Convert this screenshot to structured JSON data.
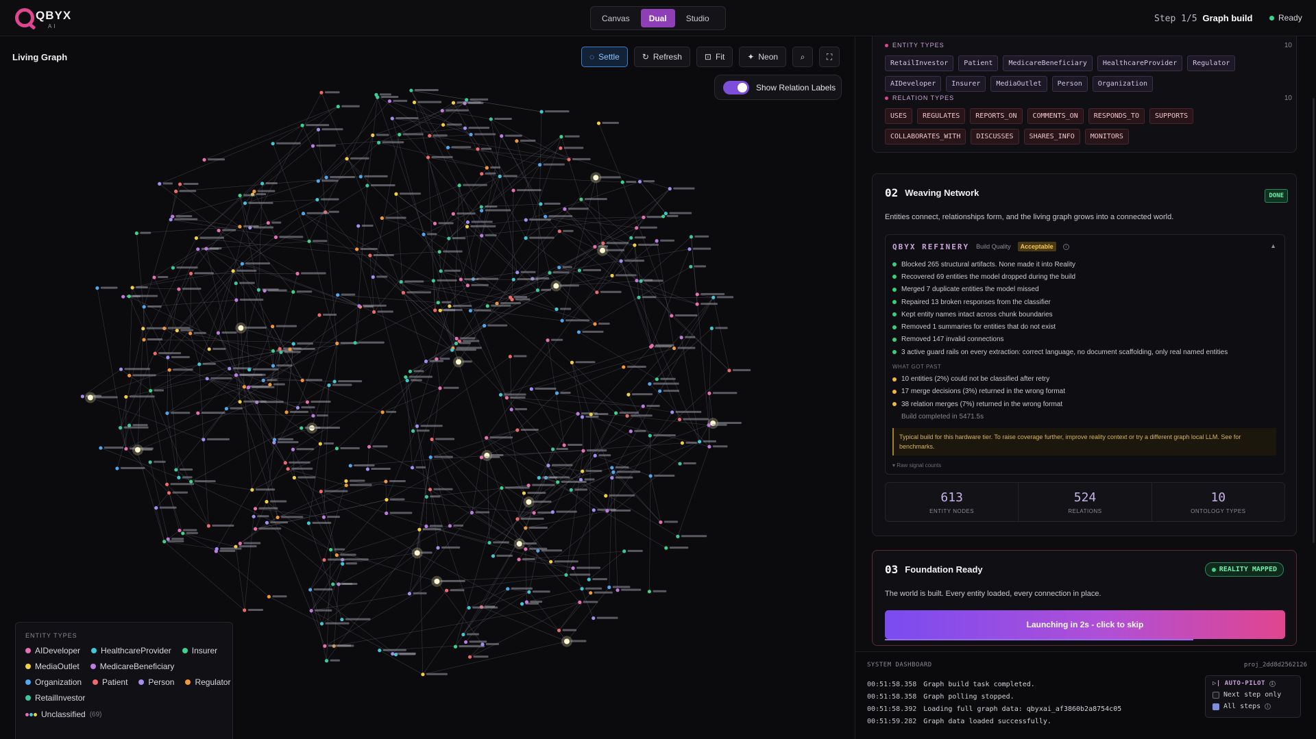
{
  "app": {
    "logo_text": "QBYX",
    "logo_sub": "AI",
    "modes": [
      "Canvas",
      "Dual",
      "Studio"
    ],
    "active_mode": "Dual",
    "step_prefix": "Step 1/5",
    "step_name": "Graph build",
    "status": "Ready"
  },
  "graph": {
    "title": "Living Graph",
    "tools": {
      "settle": "Settle",
      "refresh": "Refresh",
      "fit": "Fit",
      "neon": "Neon"
    },
    "toggle_label": "Show Relation Labels",
    "toggle_on": true,
    "legend_title": "ENTITY TYPES",
    "legend": [
      {
        "label": "AIDeveloper",
        "color": "#e86fb3"
      },
      {
        "label": "HealthcareProvider",
        "color": "#3fc9d8"
      },
      {
        "label": "Insurer",
        "color": "#3ad48a"
      },
      {
        "label": "MediaOutlet",
        "color": "#f3cf43"
      },
      {
        "label": "MedicareBeneficiary",
        "color": "#c07be3"
      },
      {
        "label": "Organization",
        "color": "#4fa8f0"
      },
      {
        "label": "Patient",
        "color": "#f06a6a"
      },
      {
        "label": "Person",
        "color": "#a48ef0"
      },
      {
        "label": "Regulator",
        "color": "#f2983a"
      },
      {
        "label": "RetailInvestor",
        "color": "#3cc99a"
      }
    ],
    "unclassified_label": "Unclassified",
    "unclassified_count": "(69)"
  },
  "ontology": {
    "entity_types_label": "ENTITY TYPES",
    "entity_types_count": "10",
    "entity_types": [
      "RetailInvestor",
      "Patient",
      "MedicareBeneficiary",
      "HealthcareProvider",
      "Regulator",
      "AIDeveloper",
      "Insurer",
      "MediaOutlet",
      "Person",
      "Organization"
    ],
    "relation_types_label": "RELATION TYPES",
    "relation_types_count": "10",
    "relation_types": [
      "USES",
      "REGULATES",
      "REPORTS_ON",
      "COMMENTS_ON",
      "RESPONDS_TO",
      "SUPPORTS",
      "COLLABORATES_WITH",
      "DISCUSSES",
      "SHARES_INFO",
      "MONITORS"
    ]
  },
  "weaving": {
    "number": "02",
    "title": "Weaving Network",
    "badge": "DONE",
    "description": "Entities connect, relationships form, and the living graph grows into a connected world.",
    "refinery_name": "QBYX REFINERY",
    "build_quality_label": "Build Quality",
    "build_quality_value": "Acceptable",
    "fixes": [
      "Blocked 265 structural artifacts. None made it into Reality",
      "Recovered 69 entities the model dropped during the build",
      "Merged 7 duplicate entities the model missed",
      "Repaired 13 broken responses from the classifier",
      "Kept entity names intact across chunk boundaries",
      "Removed 1 summaries for entities that do not exist",
      "Removed 147 invalid connections",
      "3 active guard rails on every extraction: correct language, no document scaffolding, only real named entities"
    ],
    "got_past_label": "WHAT GOT PAST",
    "got_past": [
      "10 entities (2%) could not be classified after retry",
      "17 merge decisions (3%) returned in the wrong format",
      "38 relation merges (7%) returned in the wrong format"
    ],
    "build_completed": "Build completed in 5471.5s",
    "hint": "Typical build for this hardware tier. To raise coverage further, improve reality context or try a different graph local LLM. See for benchmarks.",
    "raw_signal": "Raw signal counts",
    "stats": [
      {
        "value": "613",
        "label": "ENTITY NODES"
      },
      {
        "value": "524",
        "label": "RELATIONS"
      },
      {
        "value": "10",
        "label": "ONTOLOGY TYPES"
      }
    ]
  },
  "foundation": {
    "number": "03",
    "title": "Foundation Ready",
    "badge": "REALITY MAPPED",
    "description": "The world is built. Every entity loaded, every connection in place.",
    "launch_label": "Launching in 2s - click to skip",
    "launch_progress": 0.77
  },
  "dashboard": {
    "title": "SYSTEM DASHBOARD",
    "project": "proj_2dd8d2562126",
    "logs": [
      {
        "time": "00:51:58.358",
        "msg": "Graph build task completed."
      },
      {
        "time": "00:51:58.358",
        "msg": "Graph polling stopped."
      },
      {
        "time": "00:51:58.392",
        "msg": "Loading full graph data: qbyxai_af3860b2a8754c05"
      },
      {
        "time": "00:51:59.282",
        "msg": "Graph data loaded successfully."
      }
    ],
    "autopilot_label": "AUTO-PILOT",
    "next_step_only": "Next step only",
    "all_steps": "All steps",
    "next_step_checked": false,
    "all_steps_checked": true
  }
}
